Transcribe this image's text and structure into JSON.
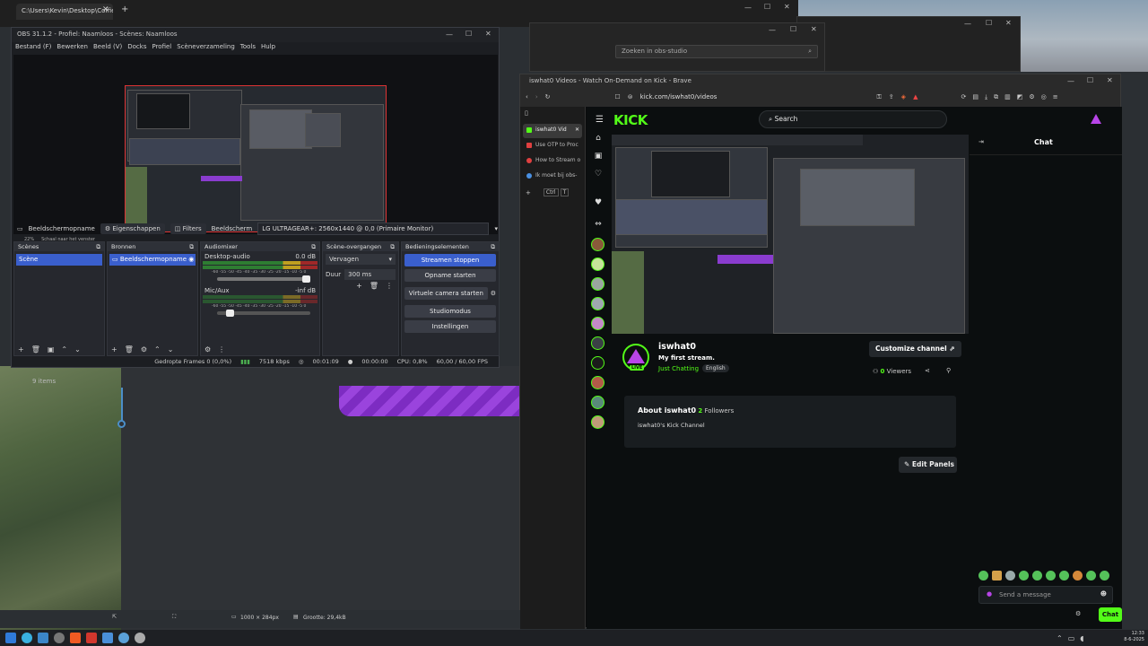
{
  "explorer": {
    "tab_title": "C:\\Users\\Kevin\\Desktop\\Coffie"
  },
  "bg_search": {
    "placeholder": "Zoeken in obs-studio"
  },
  "status_items": "9 items",
  "obs": {
    "title": "OBS 31.1.2 - Profiel: Naamloos - Scènes: Naamloos",
    "menu": [
      "Bestand (F)",
      "Bewerken",
      "Beeld (V)",
      "Docks",
      "Profiel",
      "Scèneverzameling",
      "Tools",
      "Hulp"
    ],
    "preview_zoom": "22%",
    "preview_mode": "Schaal naar het venster",
    "source_name": "Beeldschermopname",
    "properties": "Eigenschappen",
    "filters": "Filters",
    "display_label": "Beeldscherm",
    "display_value": "LG ULTRAGEAR+: 2560x1440 @ 0,0 (Primaire Monitor)",
    "docks": {
      "scenes": {
        "title": "Scènes",
        "items": [
          "Scène"
        ]
      },
      "sources": {
        "title": "Bronnen",
        "items": [
          "Beeldschermopname"
        ]
      },
      "mixer": {
        "title": "Audiomixer",
        "channels": [
          {
            "name": "Desktop-audio",
            "db": "0.0 dB",
            "level": 0.8
          },
          {
            "name": "Mic/Aux",
            "db": "-inf dB",
            "level": 0.1
          }
        ],
        "ticks": "-60 -55 -50 -45 -40 -35 -30 -25 -20 -15 -10 -5 0"
      },
      "transitions": {
        "title": "Scène-overgangen",
        "type": "Vervagen",
        "duration_label": "Duur",
        "duration": "300 ms"
      },
      "controls": {
        "title": "Bedieningselementen",
        "buttons": [
          "Streamen stoppen",
          "Opname starten",
          "Virtuele camera starten",
          "Studiomodus",
          "Instellingen"
        ]
      }
    },
    "status": {
      "dropped": "Gedropte Frames 0 (0,0%)",
      "kbps": "7518 kbps",
      "stream_time": "00:01:09",
      "rec_time": "00:00:00",
      "cpu": "CPU: 0,8%",
      "fps": "60,00 / 60,00 FPS"
    }
  },
  "brave": {
    "title": "iswhat0 Videos - Watch On-Demand on Kick - Brave",
    "url": "kick.com/iswhat0/videos",
    "tabs": [
      {
        "label": "iswhat0 Vid",
        "color": "#53fc18",
        "active": true
      },
      {
        "label": "Use OTP to Proc",
        "color": "#e04040",
        "active": false
      },
      {
        "label": "How to Stream o",
        "color": "#e04040",
        "active": false
      },
      {
        "label": "Ik moet bij obs-",
        "color": "#4a90e2",
        "active": false
      }
    ],
    "tab_shortcut": [
      "Ctrl",
      "T"
    ]
  },
  "kick": {
    "logo": "KICK",
    "search_placeholder": "Search",
    "chat_title": "Chat",
    "channel": {
      "name": "iswhat0",
      "stream_title": "My first stream.",
      "category": "Just Chatting",
      "language": "English",
      "live_badge": "LIVE",
      "customize_label": "Customize channel",
      "viewers_count": "0",
      "viewers_label": "Viewers"
    },
    "about": {
      "heading": "About iswhat0",
      "followers_count": "2",
      "followers_label": "Followers",
      "description": "iswhat0's Kick Channel"
    },
    "edit_panels": "Edit Panels",
    "chat_placeholder": "Send a message",
    "chat_button": "Chat"
  },
  "paint": {
    "dimensions": "1000 × 284px",
    "size": "Grootte: 29,4kB"
  },
  "clock": {
    "time": "12:33",
    "date": "8-6-2025"
  },
  "colors": {
    "kick_green": "#53fc18",
    "obs_accent": "#3a5fcd",
    "record_red": "#d33333"
  }
}
